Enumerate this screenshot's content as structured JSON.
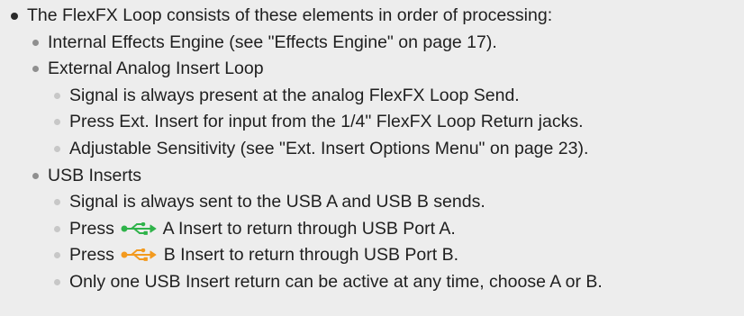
{
  "doc": {
    "intro": "The FlexFX Loop consists of these elements in order of processing:",
    "internal_engine": "Internal Effects Engine (see \"Effects Engine\" on page 17).",
    "external_loop": {
      "heading": "External Analog Insert Loop",
      "items": [
        "Signal is always present at the analog FlexFX Loop Send.",
        "Press Ext. Insert for input from the 1/4\" FlexFX Loop Return jacks.",
        "Adjustable Sensitivity (see \"Ext. Insert Options Menu\" on page 23)."
      ]
    },
    "usb_inserts": {
      "heading": "USB Inserts",
      "always_sent": "Signal is always sent to the USB A and USB B sends.",
      "press_a_prefix": "Press",
      "press_a_suffix": "A Insert to return through USB Port A.",
      "press_b_prefix": "Press",
      "press_b_suffix": "B Insert to return through USB Port B.",
      "only_one": "Only one USB Insert return can be active at any time, choose A or B."
    },
    "icons": {
      "usb_a": "usb-icon",
      "usb_b": "usb-icon"
    },
    "colors": {
      "usb_a_icon": "#2fb34a",
      "usb_b_icon": "#f39a1f"
    }
  }
}
